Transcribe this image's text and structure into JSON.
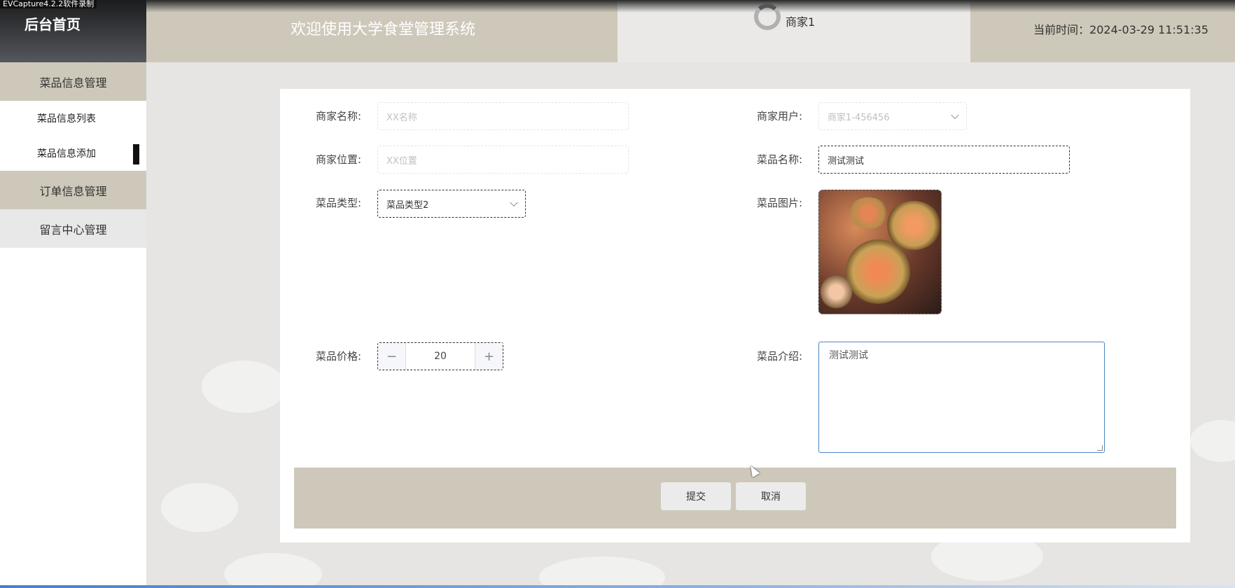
{
  "watermark": "EVCapture4.2.2软件录制",
  "sidebar": {
    "home_label": "后台首页",
    "groups": [
      {
        "label": "菜品信息管理",
        "items": [
          {
            "label": "菜品信息列表"
          },
          {
            "label": "菜品信息添加",
            "active": true
          }
        ]
      },
      {
        "label": "订单信息管理"
      },
      {
        "label": "留言中心管理"
      }
    ]
  },
  "header": {
    "title": "欢迎使用大学食堂管理系统",
    "user": "商家1",
    "time": "当前时间：2024-03-29 11:51:35"
  },
  "form": {
    "merchant_name": {
      "label": "商家名称:",
      "placeholder": "XX名称"
    },
    "merchant_user": {
      "label": "商家用户:",
      "value": "商家1-456456"
    },
    "merchant_location": {
      "label": "商家位置:",
      "placeholder": "XX位置"
    },
    "dish_name": {
      "label": "菜品名称:",
      "value": "测试测试"
    },
    "dish_type": {
      "label": "菜品类型:",
      "value": "菜品类型2"
    },
    "dish_image": {
      "label": "菜品图片:"
    },
    "dish_price": {
      "label": "菜品价格:",
      "value": "20",
      "minus": "−",
      "plus": "+"
    },
    "dish_intro": {
      "label": "菜品介绍:",
      "value": "测试测试"
    },
    "submit_label": "提交",
    "cancel_label": "取消"
  },
  "icons": {
    "select_arrow": "chevron-down-icon",
    "loading": "spinner-icon",
    "cursor": "mouse-cursor-icon"
  },
  "colors": {
    "accent_beige": "#cdc8b9",
    "focus_blue": "#4a86c8"
  }
}
